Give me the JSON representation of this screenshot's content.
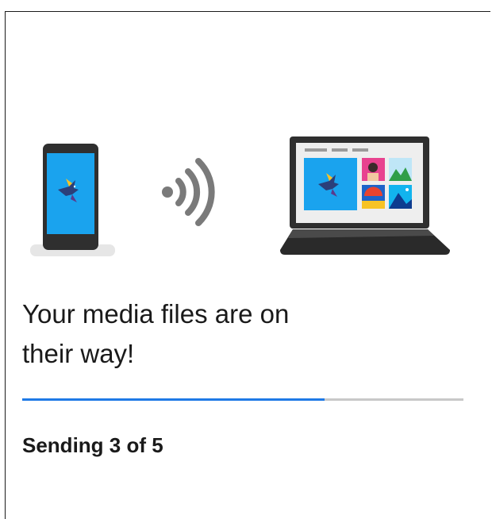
{
  "message": {
    "headline_line1": "Your media files are on",
    "headline_line2": "their way!"
  },
  "progress": {
    "fraction": 0.685,
    "status_text": "Sending 3 of 5",
    "current": 3,
    "total": 5
  },
  "colors": {
    "progress_fill": "#1f7ae6",
    "progress_track": "#c8c8c8",
    "text": "#1a1a1a",
    "screen_blue": "#1aa3ee",
    "device_dark": "#2f2f2f",
    "signal_gray": "#7a7a7a"
  },
  "icons": {
    "phone": "smartphone-icon",
    "signal": "wireless-signal-icon",
    "laptop": "laptop-icon",
    "bird": "bird-icon"
  }
}
